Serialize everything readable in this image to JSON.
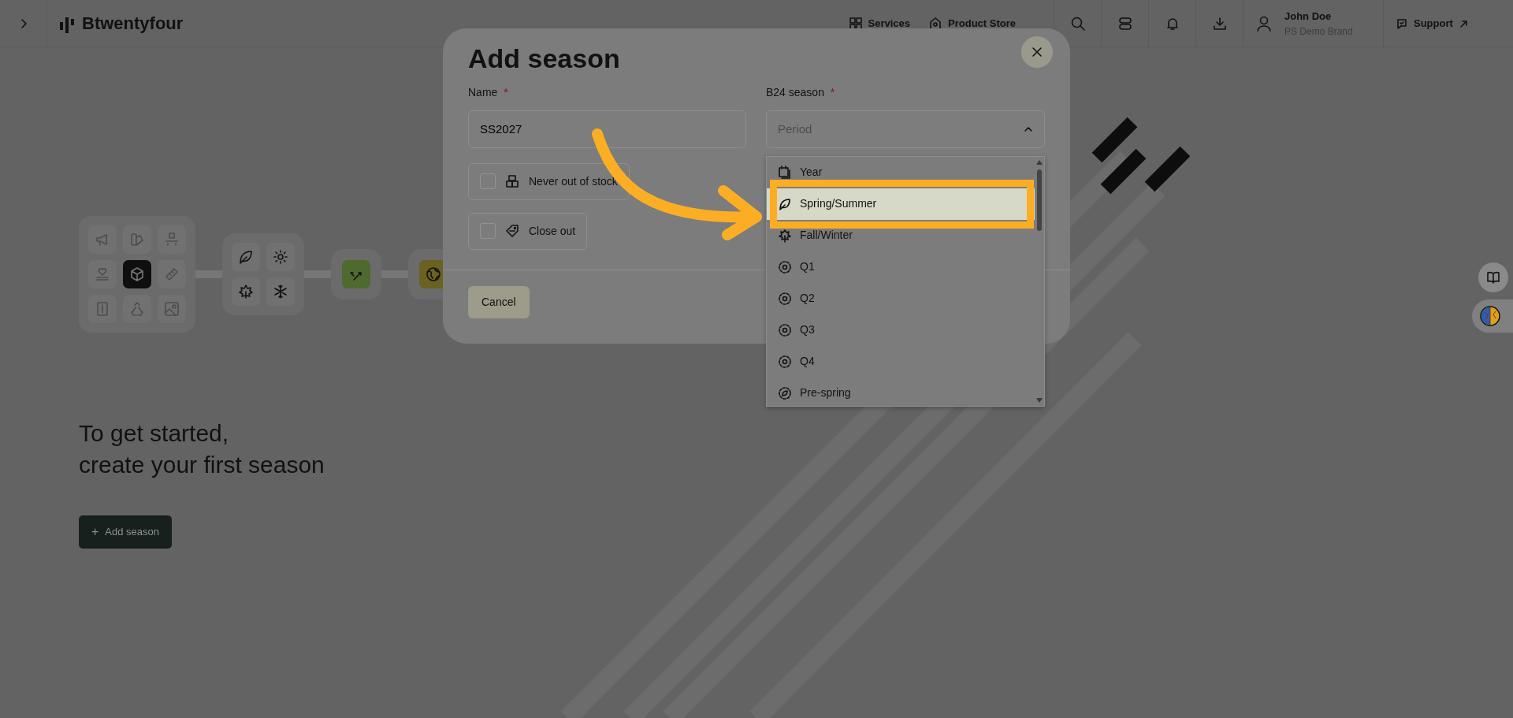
{
  "topbar": {
    "logo": "Btwentyfour",
    "nav": [
      {
        "label": "Services"
      },
      {
        "label": "Product Store"
      }
    ],
    "user": {
      "name": "John Doe",
      "brand": "PS Demo Brand"
    },
    "support": "Support"
  },
  "page": {
    "heading_lines": [
      "To get started,",
      "create your first season"
    ],
    "add_button": {
      "icon": "+",
      "label": "Add season"
    }
  },
  "modal": {
    "title": "Add season",
    "name_field": {
      "label": "Name",
      "required_mark": "*",
      "value": "SS2027"
    },
    "season_field": {
      "label": "B24 season",
      "required_mark": "*",
      "placeholder": "Period",
      "expanded": true
    },
    "checkboxes": [
      {
        "label": "Never out of stock",
        "checked": false
      },
      {
        "label": "Close out",
        "checked": false
      }
    ],
    "cancel": "Cancel"
  },
  "dropdown": {
    "options": [
      {
        "label": "Year",
        "selected": false
      },
      {
        "label": "Spring/Summer",
        "selected": true
      },
      {
        "label": "Fall/Winter",
        "selected": false
      },
      {
        "label": "Q1",
        "selected": false
      },
      {
        "label": "Q2",
        "selected": false
      },
      {
        "label": "Q3",
        "selected": false
      },
      {
        "label": "Q4",
        "selected": false
      },
      {
        "label": "Pre-spring",
        "selected": false
      }
    ]
  }
}
